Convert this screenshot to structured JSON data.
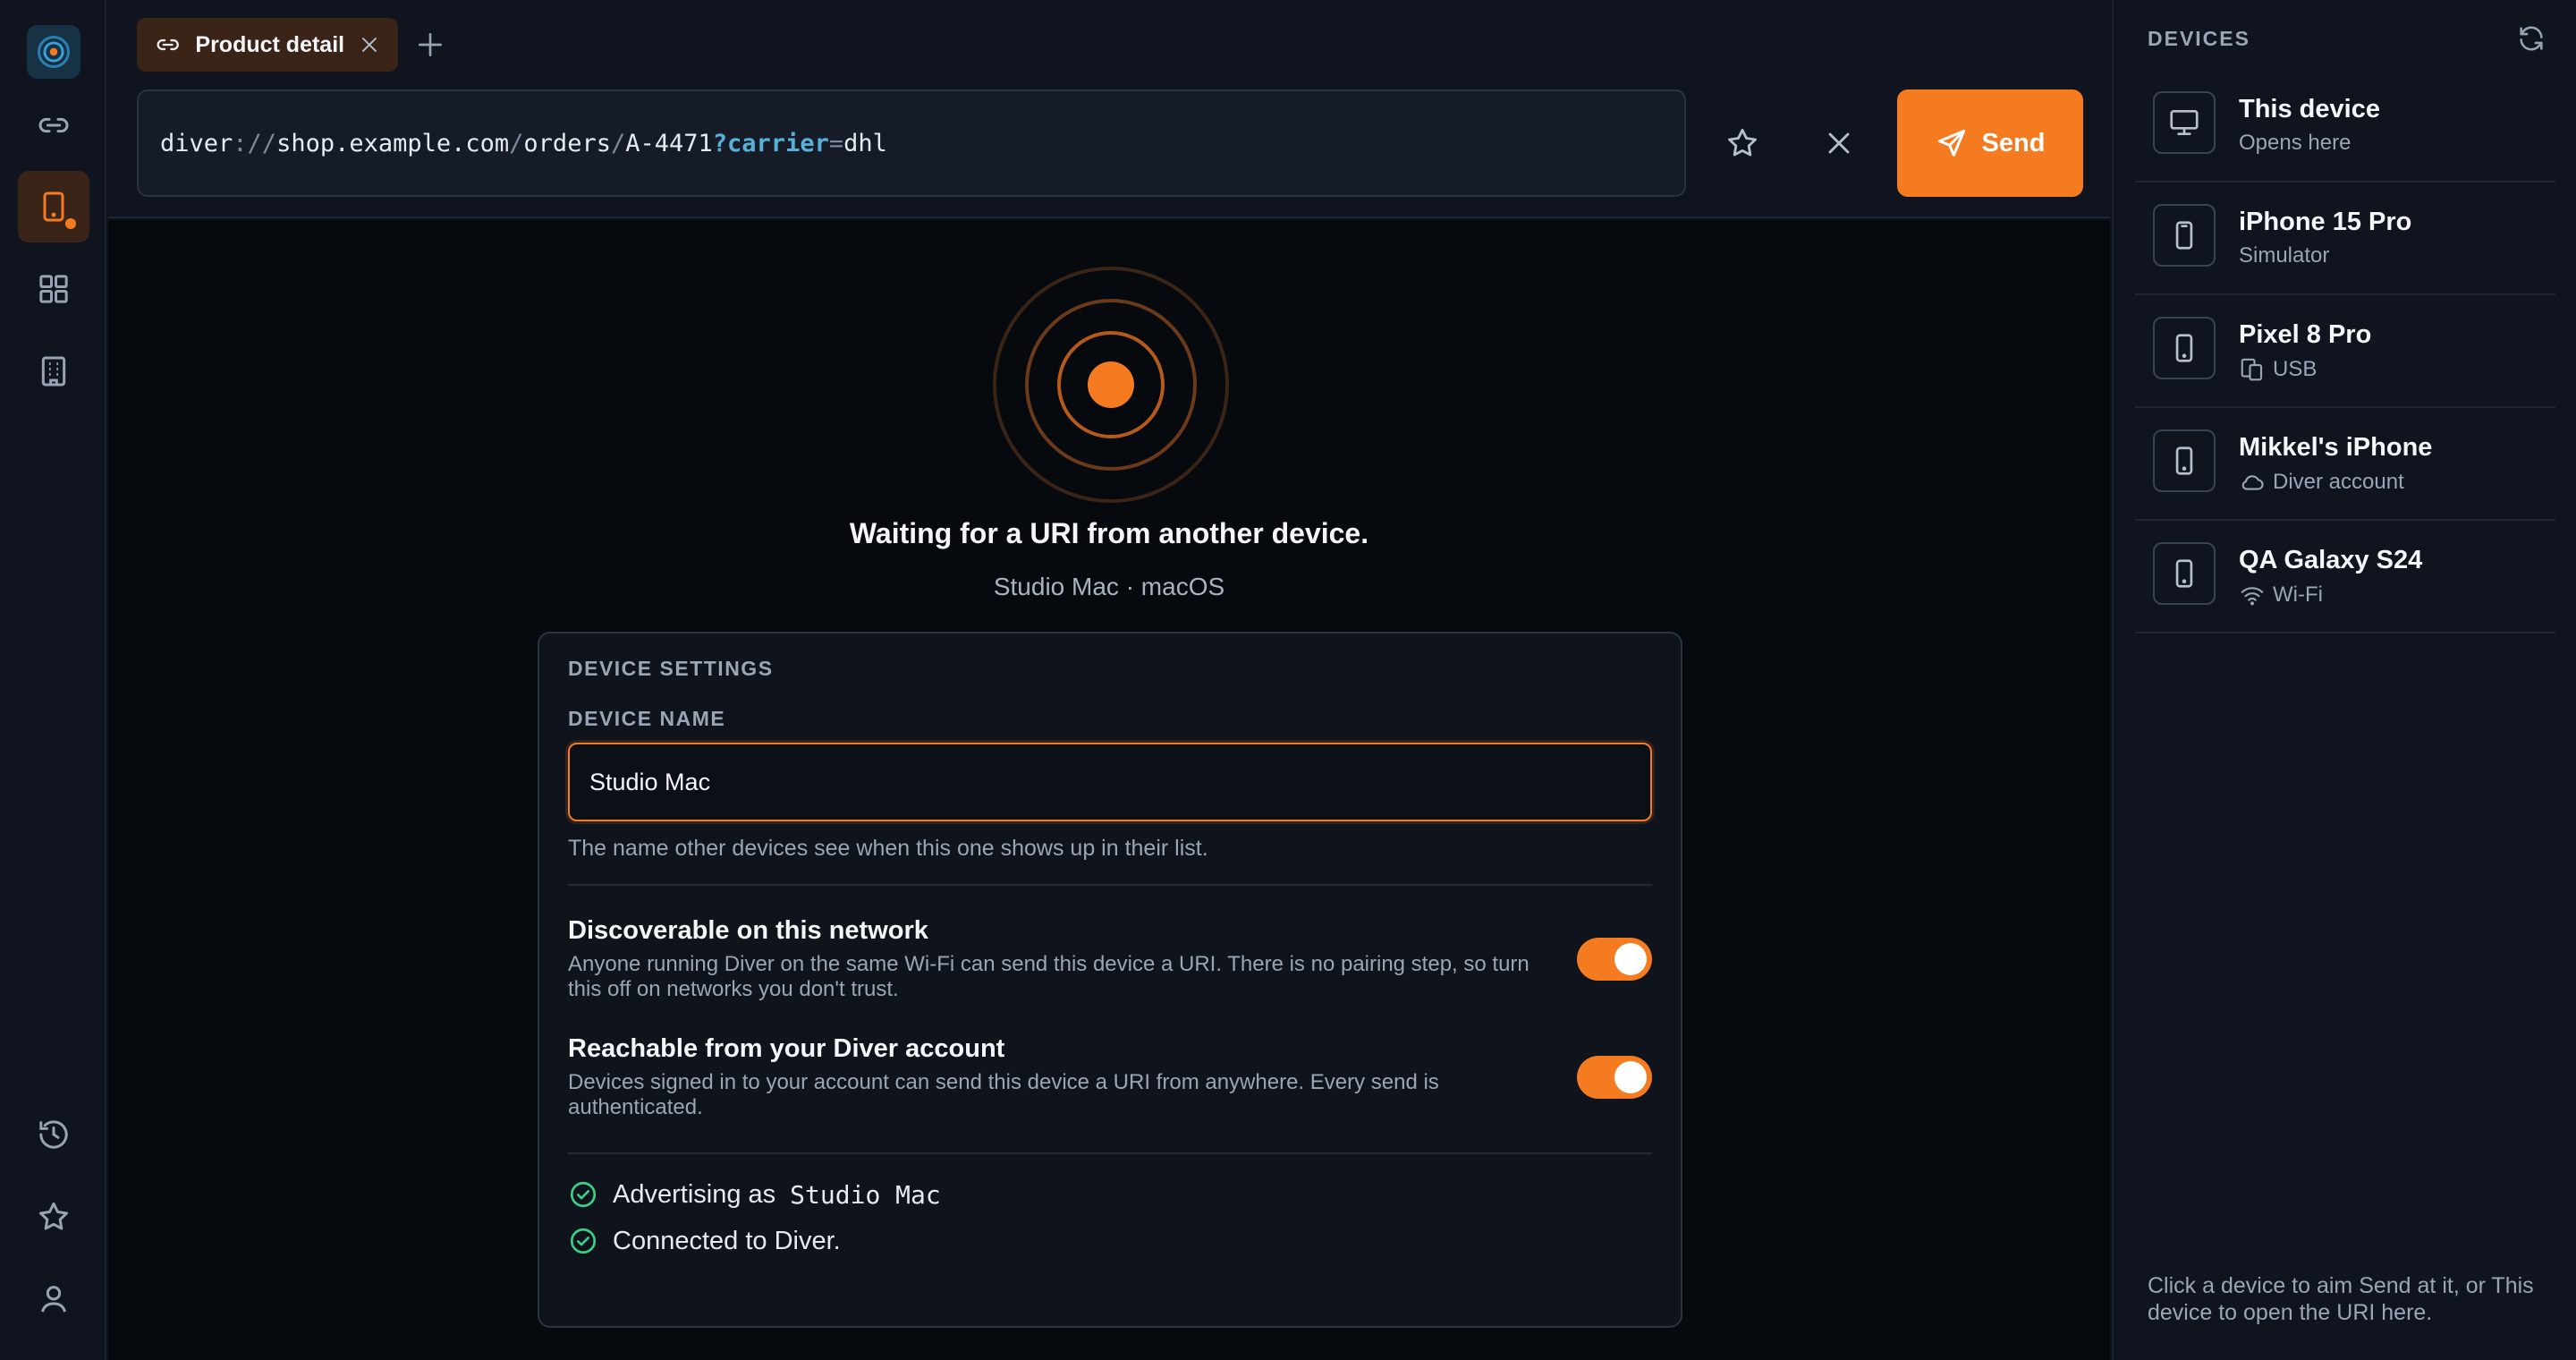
{
  "rail": {
    "logo_icon": "radar-logo-icon",
    "items": [
      {
        "icon": "link-icon"
      },
      {
        "icon": "device-icon",
        "active": true
      },
      {
        "icon": "grid-icon"
      },
      {
        "icon": "building-icon"
      }
    ],
    "bottom_items": [
      {
        "icon": "history-icon"
      },
      {
        "icon": "star-icon"
      },
      {
        "icon": "user-icon"
      }
    ]
  },
  "tabs": [
    {
      "label": "Product detail",
      "icon": "link-icon",
      "active": true
    }
  ],
  "url": {
    "scheme": "diver",
    "sep": "://",
    "host": "shop.example.com",
    "slash1": "/",
    "seg1": "orders",
    "slash2": "/",
    "seg2": "A-4471",
    "q": "?",
    "param_key": "carrier",
    "eq": "=",
    "param_value": "dhl"
  },
  "toolbar": {
    "send_label": "Send"
  },
  "waiting": {
    "message": "Waiting for a URI from another device.",
    "device_line": "Studio Mac · macOS"
  },
  "settings": {
    "title": "DEVICE SETTINGS",
    "name_label": "DEVICE NAME",
    "name_value": "Studio Mac",
    "name_help": "The name other devices see when this one shows up in their list.",
    "options": [
      {
        "title": "Discoverable on this network",
        "desc": "Anyone running Diver on the same Wi-Fi can send this device a URI. There is no pairing step, so turn this off on networks you don't trust.",
        "enabled": true
      },
      {
        "title": "Reachable from your Diver account",
        "desc": "Devices signed in to your account can send this device a URI from anywhere. Every send is authenticated.",
        "enabled": true
      }
    ],
    "status": {
      "advertising_prefix": "Advertising as",
      "advertising_name": "Studio Mac",
      "connected": "Connected to Diver."
    }
  },
  "devices": {
    "title": "DEVICES",
    "items": [
      {
        "name": "This device",
        "sub": "Opens here",
        "icon": "monitor-icon",
        "sub_icon": ""
      },
      {
        "name": "iPhone 15 Pro",
        "sub": "Simulator",
        "icon": "phone-simulator-icon",
        "sub_icon": ""
      },
      {
        "name": "Pixel 8 Pro",
        "sub": "USB",
        "icon": "phone-icon",
        "sub_icon": "usb-devices-icon"
      },
      {
        "name": "Mikkel's iPhone",
        "sub": "Diver account",
        "icon": "phone-icon",
        "sub_icon": "cloud-icon"
      },
      {
        "name": "QA Galaxy S24",
        "sub": "Wi-Fi",
        "icon": "phone-icon",
        "sub_icon": "wifi-icon"
      }
    ],
    "footer": "Click a device to aim Send at it, or This device to open the URI here."
  },
  "colors": {
    "accent": "#f47b20",
    "success": "#3ccf87",
    "query_key": "#58b0d6"
  }
}
